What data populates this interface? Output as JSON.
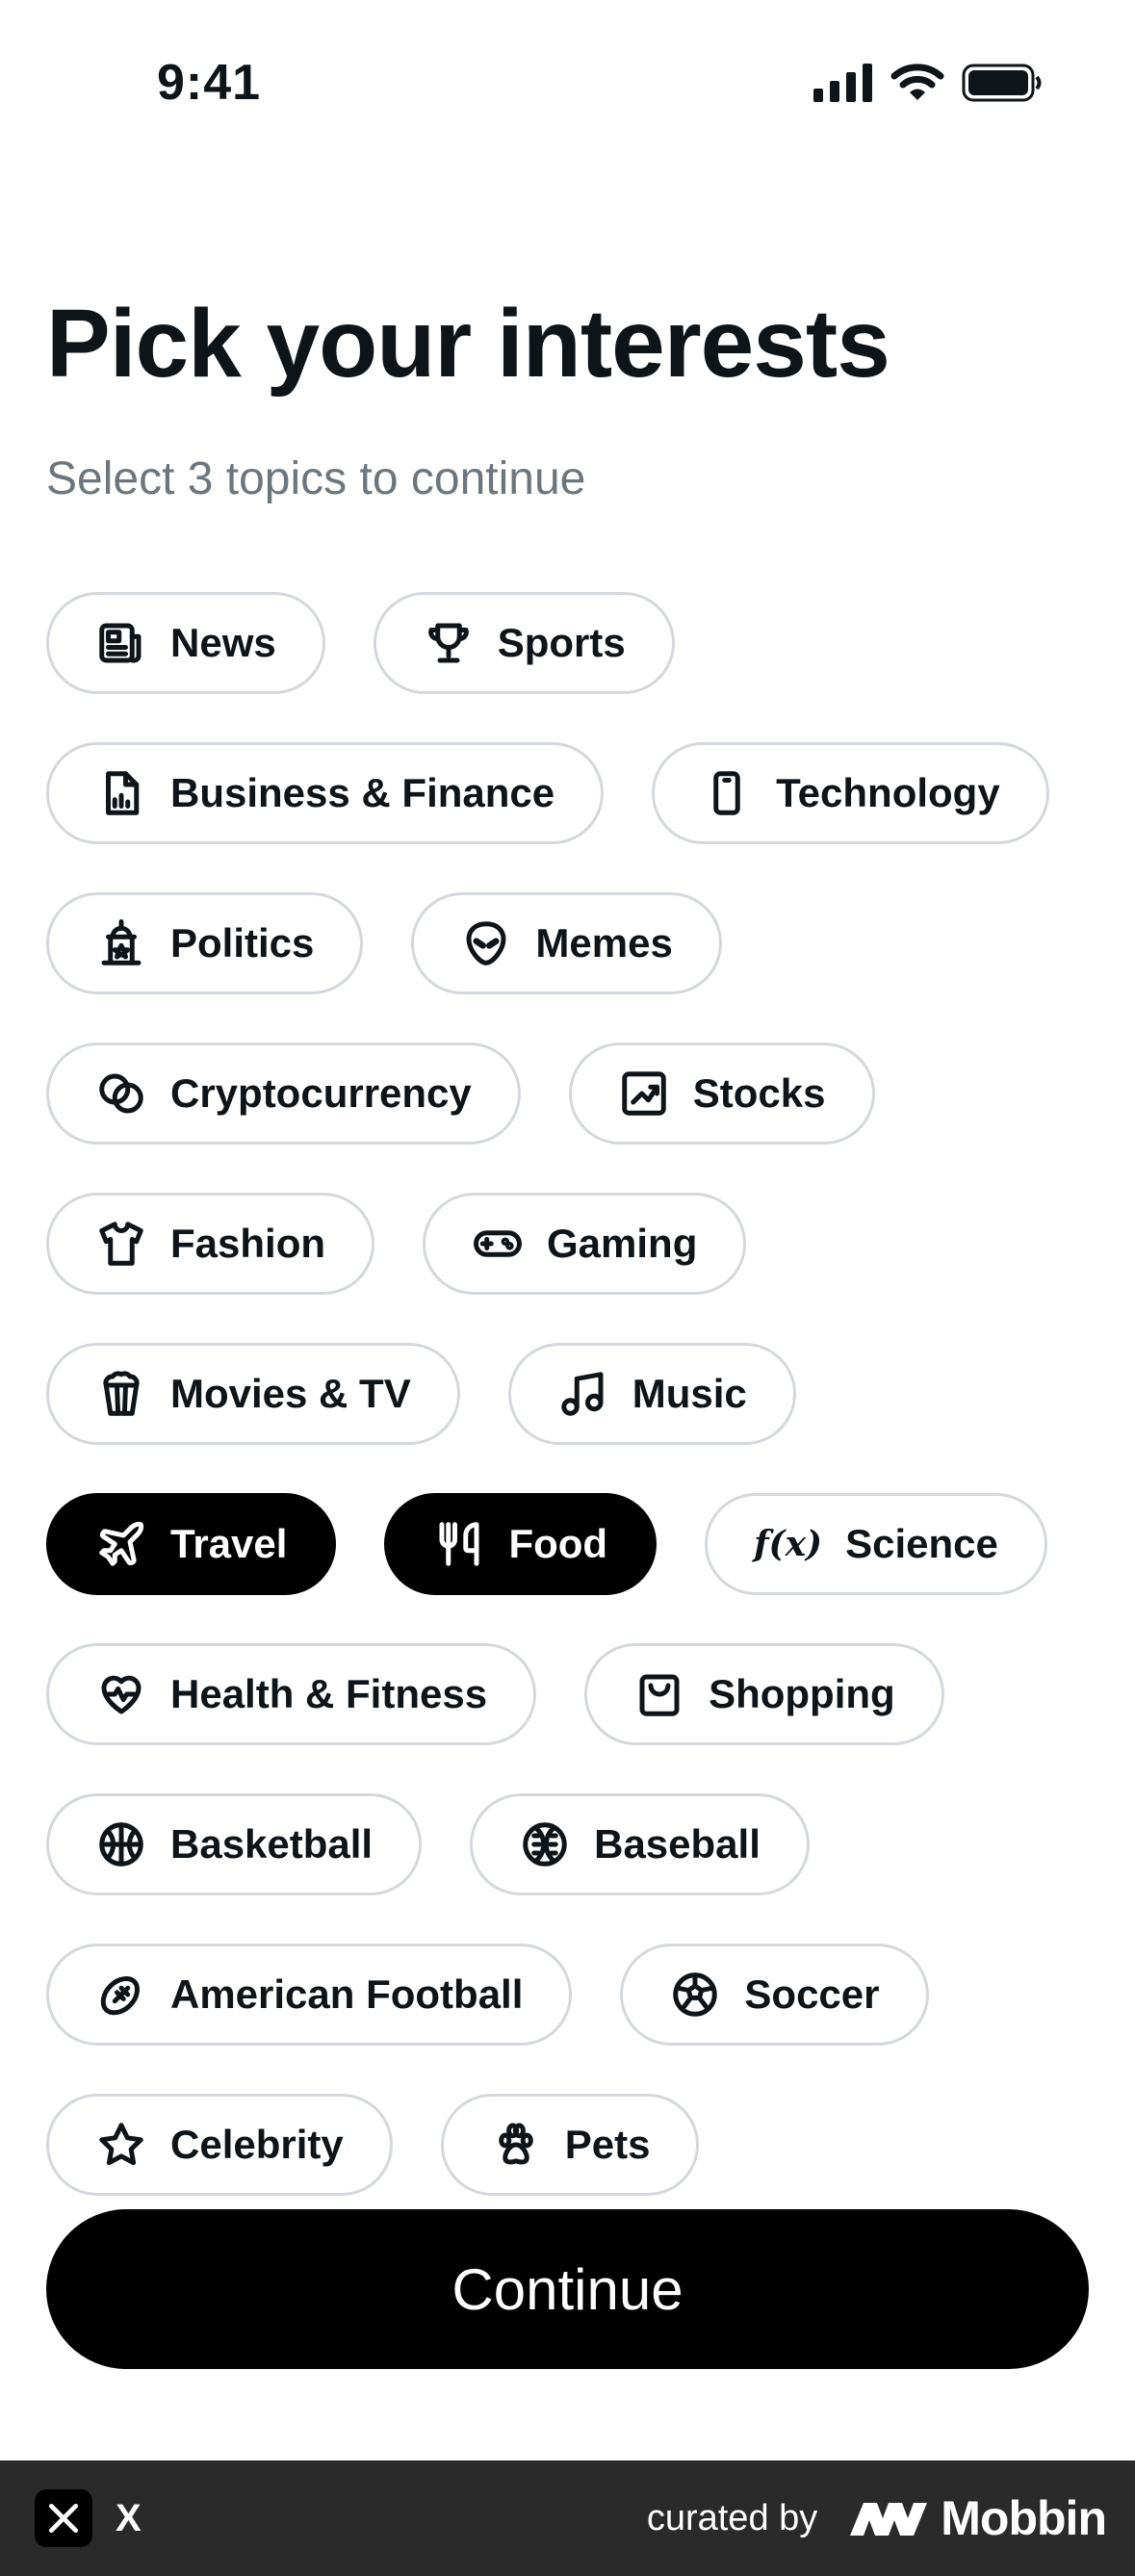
{
  "status": {
    "time": "9:41"
  },
  "title": "Pick your interests",
  "subtitle": "Select 3 topics to continue",
  "rows": [
    [
      {
        "label": "News",
        "icon": "news-icon",
        "selected": false
      },
      {
        "label": "Sports",
        "icon": "trophy-icon",
        "selected": false
      }
    ],
    [
      {
        "label": "Business & Finance",
        "icon": "business-chart-icon",
        "selected": false
      },
      {
        "label": "Technology",
        "icon": "phone-icon",
        "selected": false
      }
    ],
    [
      {
        "label": "Politics",
        "icon": "capitol-icon",
        "selected": false
      },
      {
        "label": "Memes",
        "icon": "alien-icon",
        "selected": false
      }
    ],
    [
      {
        "label": "Cryptocurrency",
        "icon": "coins-icon",
        "selected": false
      },
      {
        "label": "Stocks",
        "icon": "stock-chart-icon",
        "selected": false
      }
    ],
    [
      {
        "label": "Fashion",
        "icon": "shirt-icon",
        "selected": false
      },
      {
        "label": "Gaming",
        "icon": "gamepad-icon",
        "selected": false
      }
    ],
    [
      {
        "label": "Movies & TV",
        "icon": "popcorn-icon",
        "selected": false
      },
      {
        "label": "Music",
        "icon": "music-note-icon",
        "selected": false
      }
    ],
    [
      {
        "label": "Travel",
        "icon": "plane-icon",
        "selected": true
      },
      {
        "label": "Food",
        "icon": "utensils-icon",
        "selected": true
      },
      {
        "label": "Science",
        "icon": "function-icon",
        "icon_text": "f(x)",
        "selected": false
      }
    ],
    [
      {
        "label": "Health & Fitness",
        "icon": "heart-pulse-icon",
        "selected": false
      },
      {
        "label": "Shopping",
        "icon": "shopping-bag-icon",
        "selected": false
      }
    ],
    [
      {
        "label": "Basketball",
        "icon": "basketball-icon",
        "selected": false
      },
      {
        "label": "Baseball",
        "icon": "baseball-icon",
        "selected": false
      }
    ],
    [
      {
        "label": "American Football",
        "icon": "football-icon",
        "selected": false
      },
      {
        "label": "Soccer",
        "icon": "soccer-ball-icon",
        "selected": false
      }
    ],
    [
      {
        "label": "Celebrity",
        "icon": "star-icon",
        "selected": false
      },
      {
        "label": "Pets",
        "icon": "paw-icon",
        "selected": false
      }
    ]
  ],
  "continue_label": "Continue",
  "footer": {
    "app_name": "X",
    "curated_by": "curated by",
    "brand": "Mobbin"
  },
  "colors": {
    "selected_bg": "#000000",
    "chip_border": "#d4d8dc",
    "subtitle": "#6e767d",
    "footer_bg": "#2a2a2a"
  }
}
